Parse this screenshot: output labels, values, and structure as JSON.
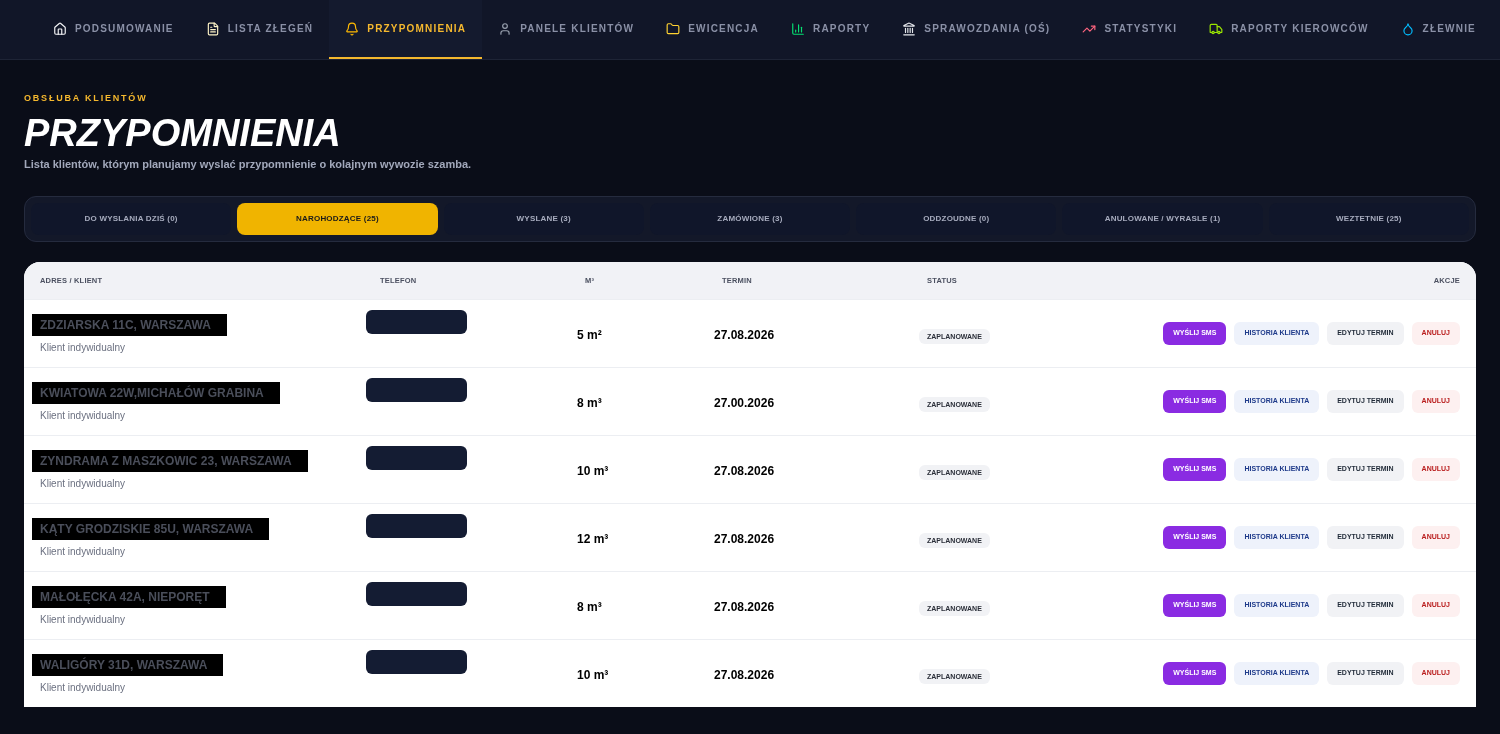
{
  "nav": [
    {
      "label": "PODSUMOWANIE",
      "selected": false
    },
    {
      "label": "LISTA ZŁEGEŃ",
      "selected": false
    },
    {
      "label": "PRZYPOMNIENIA",
      "selected": true
    },
    {
      "label": "PANELE KLIENTÓW",
      "selected": false
    },
    {
      "label": "EWICENCJA",
      "selected": false
    },
    {
      "label": "RAPORTY",
      "selected": false
    },
    {
      "label": "SPRAWOZDANIA (OŚ)",
      "selected": false
    },
    {
      "label": "STATYSTYKI",
      "selected": false
    },
    {
      "label": "RAPORTY KIEROWCÓW",
      "selected": false
    },
    {
      "label": "ZŁEWNIE",
      "selected": false
    }
  ],
  "header": {
    "eyebrow": "OBSŁUBA KLIENTÓW",
    "title": "PRZYPOMNIENIA",
    "subtitle": "Lista klientów, którym planujamy wyslać przypomnienie o kolajnym wywozie szamba."
  },
  "filters": [
    {
      "label": "DO WYSLANIA DZIŚ (0)",
      "selected": false
    },
    {
      "label": "NAROHODZĄCE (25)",
      "selected": true
    },
    {
      "label": "WYSLANE (3)",
      "selected": false
    },
    {
      "label": "ZAMÓWIONE (3)",
      "selected": false
    },
    {
      "label": "ODDZOUDNE (0)",
      "selected": false
    },
    {
      "label": "ANULOWANE / WYRASLE (1)",
      "selected": false
    },
    {
      "label": "WEZTETNIE (25)",
      "selected": false
    }
  ],
  "table": {
    "columns": [
      "ADRES / KLIENT",
      "TELEFON",
      "M³",
      "TERMIN",
      "STATUS",
      "AKCJE"
    ],
    "rows": [
      {
        "address": "ZDZIARSKA 11C, WARSZAWA",
        "client": "Klient indywidualny",
        "volume": "5 m²",
        "date": "27.08.2026",
        "status": "ZAPLANOWANE",
        "actions": [
          "WYŚLIJ SMS",
          "HISTORIA KLIENTA",
          "EDYTUJ TERMIN",
          "ANULUJ"
        ]
      },
      {
        "address": "KWIATOWA 22W,MICHAŁÓW GRABINA",
        "client": "Klient indywidualny",
        "volume": "8 m³",
        "date": "27.00.2026",
        "status": "ZAPLANOWANE",
        "actions": [
          "WYŚLIJ SMS",
          "HISTORIA KLIENTA",
          "EDYTUJ TERMIN",
          "ANULUJ"
        ]
      },
      {
        "address": "ZYNDRAMA Z MASZKOWIC 23, WARSZAWA",
        "client": "Klient indywidualny",
        "volume": "10 m³",
        "date": "27.08.2026",
        "status": "ZAPLANOWANE",
        "actions": [
          "WYŚLIJ SMS",
          "HISTORIA KLIENTA",
          "EDYTUJ TERMIN",
          "ANULUJ"
        ]
      },
      {
        "address": "KĄTY GRODZISKIE 85U, WARSZAWA",
        "client": "Klient indywidualny",
        "volume": "12 m³",
        "date": "27.08.2026",
        "status": "ZAPLANOWANE",
        "actions": [
          "WYŚLIJ SMS",
          "HISTORIA KLIENTA",
          "EDYTUJ TERMIN",
          "ANULUJ"
        ]
      },
      {
        "address": "MAŁOŁĘCKA 42A, NIEPORĘT",
        "client": "Klient indywidualny",
        "volume": "8 m³",
        "date": "27.08.2026",
        "status": "ZAPLANOWANE",
        "actions": [
          "WYŚLIJ SMS",
          "HISTORIA KLIENTA",
          "EDYTUJ TERMIN",
          "ANULUJ"
        ]
      },
      {
        "address": "WALIGÓRY 31D, WARSZAWA",
        "client": "Klient indywidualny",
        "volume": "10 m³",
        "date": "27.08.2026",
        "status": "ZAPLANOWANE",
        "actions": [
          "WYŚLIJ SMS",
          "HISTORIA KLIENTA",
          "EDYTUJ TERMIN",
          "ANULUJ"
        ]
      }
    ]
  }
}
